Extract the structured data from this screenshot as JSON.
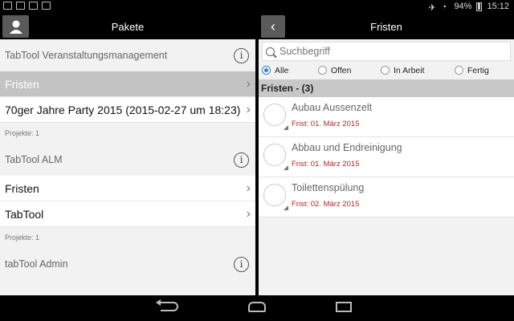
{
  "status_bar": {
    "battery": "94%",
    "time": "15:12"
  },
  "left": {
    "title": "Pakete",
    "groups": [
      {
        "name": "TabTool Veranstaltungsmanagement",
        "items": [
          {
            "label": "Fristen",
            "selected": true
          },
          {
            "label": "70ger Jahre Party 2015 (2015-02-27 um 18:23)"
          }
        ],
        "projects": "Projekte: 1"
      },
      {
        "name": "TabTool ALM",
        "items": [
          {
            "label": "Fristen"
          },
          {
            "label": "TabTool"
          }
        ],
        "projects": "Projekte: 1"
      },
      {
        "name": "tabTool Admin"
      }
    ]
  },
  "right": {
    "title": "Fristen",
    "search_placeholder": "Suchbegriff",
    "filters": [
      "Alle",
      "Offen",
      "In Arbeit",
      "Fertig"
    ],
    "section": "Fristen - (3)",
    "tasks": [
      {
        "title": "Aubau Aussenzelt",
        "due": "Frist: 01. März 2015"
      },
      {
        "title": "Abbau und Endreinigung",
        "due": "Frist: 01. März 2015"
      },
      {
        "title": "Toilettenspülung",
        "due": "Frist: 02. März 2015"
      }
    ]
  },
  "colors": {
    "accent": "#2a7fd4",
    "due_red": "#b32525",
    "selected_row": "#c3c3c3"
  }
}
